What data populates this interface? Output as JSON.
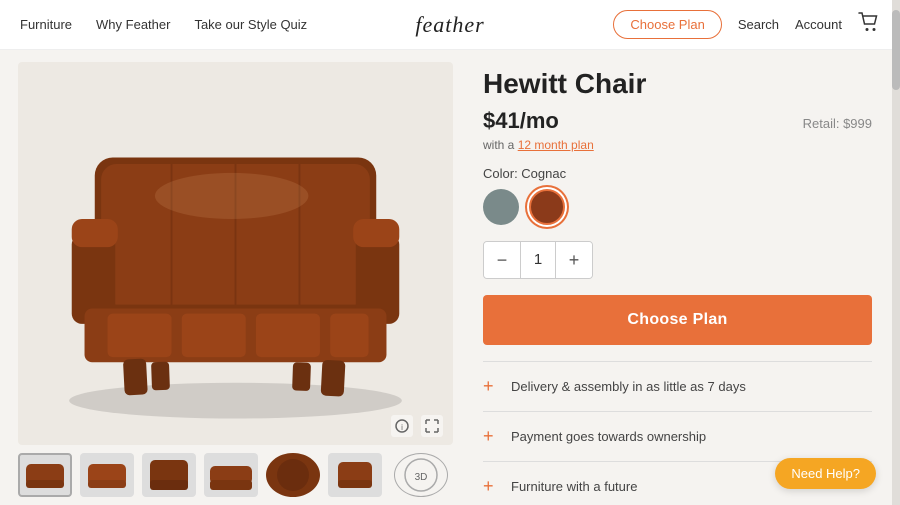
{
  "nav": {
    "links": [
      {
        "id": "furniture",
        "label": "Furniture"
      },
      {
        "id": "why-feather",
        "label": "Why Feather"
      },
      {
        "id": "style-quiz",
        "label": "Take our Style Quiz"
      }
    ],
    "logo": "feather",
    "right_links": [
      {
        "id": "search",
        "label": "Search"
      },
      {
        "id": "account",
        "label": "Account"
      }
    ],
    "choose_plan_label": "Choose Plan"
  },
  "product": {
    "title": "Hewitt Chair",
    "price": "$41/mo",
    "plan_note": "with a ",
    "plan_link_text": "12 month plan",
    "retail_label": "Retail: $999",
    "color_label": "Color: Cognac",
    "quantity": 1,
    "swatches": [
      {
        "id": "gray",
        "label": "Gray",
        "selected": false
      },
      {
        "id": "cognac",
        "label": "Cognac",
        "selected": true
      }
    ],
    "choose_plan_btn": "Choose Plan",
    "accordion": [
      {
        "id": "delivery",
        "label": "Delivery & assembly in as little as 7 days"
      },
      {
        "id": "payment",
        "label": "Payment goes towards ownership"
      },
      {
        "id": "future",
        "label": "Furniture with a future"
      }
    ]
  },
  "thumbnails": [
    {
      "id": "thumb1",
      "label": "View 1"
    },
    {
      "id": "thumb2",
      "label": "View 2"
    },
    {
      "id": "thumb3",
      "label": "View 3"
    },
    {
      "id": "thumb4",
      "label": "View 4"
    },
    {
      "id": "thumb5",
      "label": "View 5"
    },
    {
      "id": "thumb6",
      "label": "View 6"
    }
  ],
  "help_btn": "Need Help?",
  "icons": {
    "cart": "🛒",
    "minus": "−",
    "plus": "+",
    "expand": "⤢",
    "info": "?",
    "plus_sm": "+"
  }
}
